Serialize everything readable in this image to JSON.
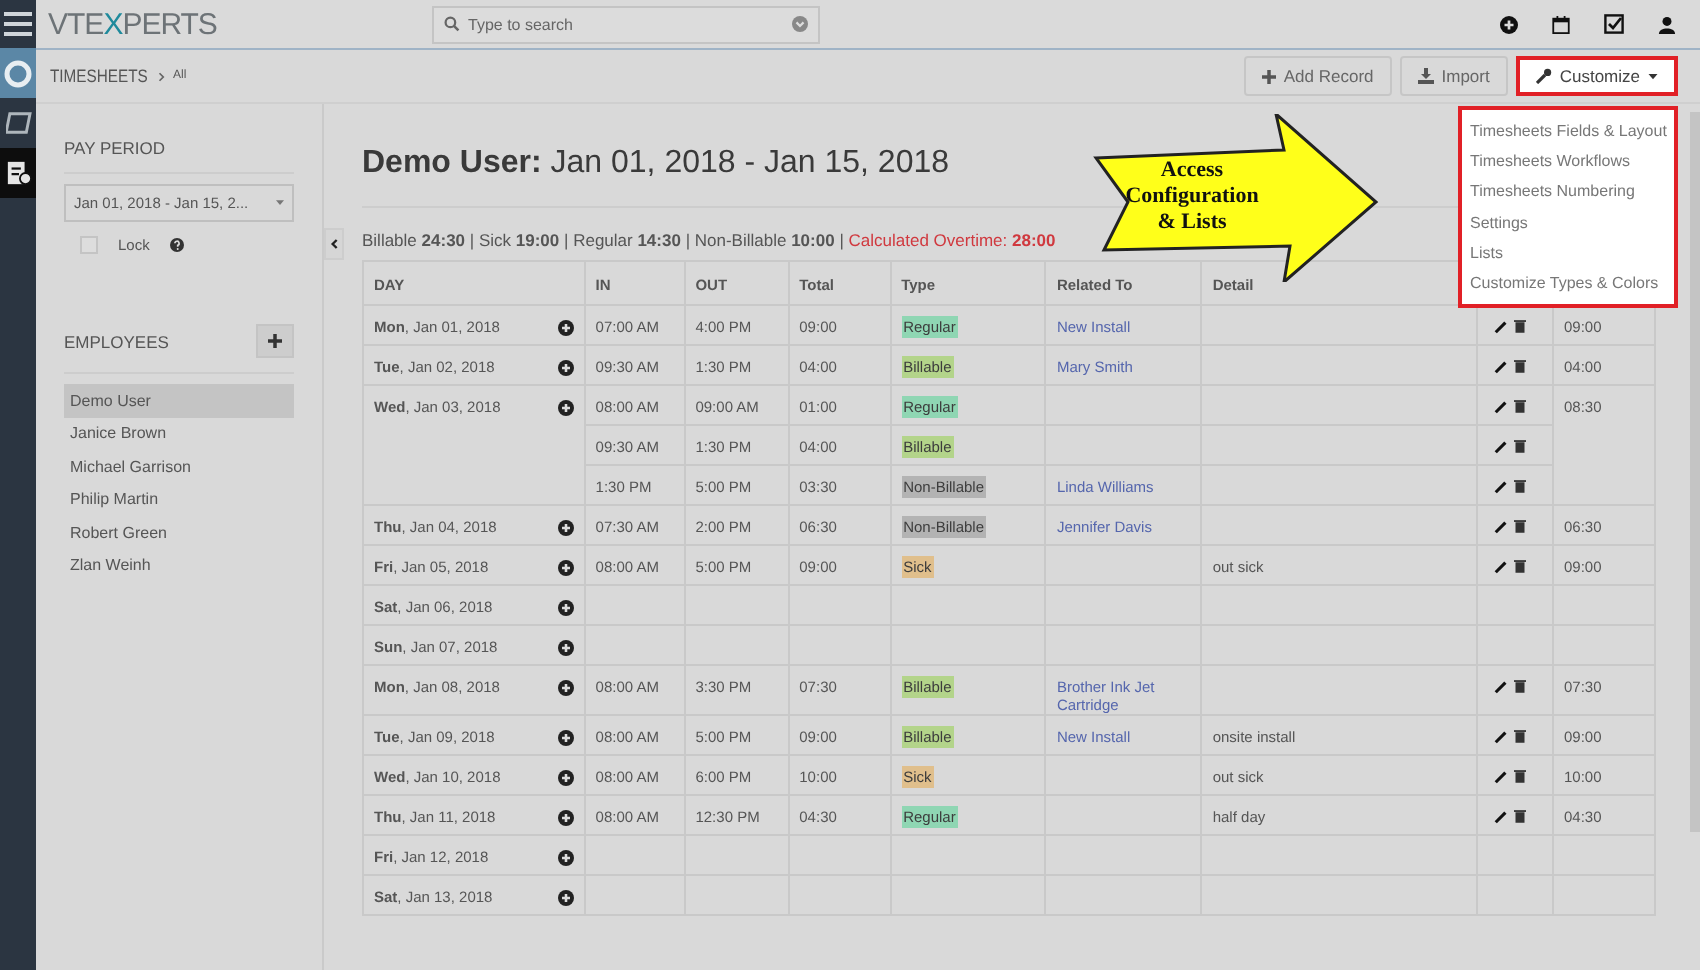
{
  "header": {
    "logo": [
      {
        "text": "VTE",
        "color": "#6d7377"
      },
      {
        "text": "X",
        "color": "#1f8a9c"
      },
      {
        "text": "PERTS",
        "color": "#6d7377"
      }
    ],
    "search": {
      "placeholder": "Type to search"
    }
  },
  "breadcrumb": {
    "module": "TIMESHEETS",
    "view": "All"
  },
  "actions": [
    {
      "kind": "add",
      "label": "Add Record",
      "highlighted": false
    },
    {
      "kind": "import",
      "label": "Import",
      "highlighted": false
    },
    {
      "kind": "customize",
      "label": "Customize",
      "highlighted": true
    }
  ],
  "customize_menu": [
    "Timesheets Fields & Layout",
    "Timesheets Workflows",
    "Timesheets Numbering",
    "Settings",
    "Lists",
    "Customize Types & Colors"
  ],
  "callout": {
    "text": "Access Configuration & Lists"
  },
  "sidebar": {
    "pay_period_label": "PAY PERIOD",
    "pay_period_value": "Jan 01, 2018 - Jan 15, 2...",
    "lock_label": "Lock",
    "lock_checked": false,
    "employees_label": "EMPLOYEES",
    "employees": [
      {
        "name": "Demo User",
        "selected": true
      },
      {
        "name": "Janice Brown",
        "selected": false
      },
      {
        "name": "Michael Garrison",
        "selected": false
      },
      {
        "name": "Philip Martin",
        "selected": false
      },
      {
        "name": "Robert Green",
        "selected": false
      },
      {
        "name": "Zlan Weinh",
        "selected": false
      }
    ]
  },
  "title": "**Demo User:** Jan 01, 2018 - Jan 15, 2018",
  "summary": "Billable **24:30** | Sick **19:00** | Regular **14:30** | Non-Billable **10:00** |",
  "overtime": "Calculated Overtime: **28:00**",
  "table": {
    "columns": [
      "DAY",
      "IN",
      "OUT",
      "Total",
      "Type",
      "Related To",
      "Detail"
    ],
    "days": [
      {
        "day": "**Mon**, Jan 01, 2018",
        "day_total": "09:00",
        "entries": [
          {
            "in": "07:00 AM",
            "out": "4:00 PM",
            "total": "09:00",
            "type": "Regular",
            "color": "#8fd6b3",
            "related": "New Install"
          }
        ]
      },
      {
        "day": "**Tue**, Jan 02, 2018",
        "day_total": "04:00",
        "entries": [
          {
            "in": "09:30 AM",
            "out": "1:30 PM",
            "total": "04:00",
            "type": "Billable",
            "color": "#b3d48a",
            "related": "Mary Smith"
          }
        ]
      },
      {
        "day": "**Wed**, Jan 03, 2018",
        "day_total": "08:30",
        "entries": [
          {
            "in": "08:00 AM",
            "out": "09:00 AM",
            "total": "01:00",
            "type": "Regular",
            "color": "#8fd6b3"
          },
          {
            "in": "09:30 AM",
            "out": "1:30 PM",
            "total": "04:00",
            "type": "Billable",
            "color": "#b3d48a"
          },
          {
            "in": "1:30 PM",
            "out": "5:00 PM",
            "total": "03:30",
            "type": "Non-Billable",
            "color": "#b3b3b3",
            "related": "Linda Williams"
          }
        ]
      },
      {
        "day": "**Thu**, Jan 04, 2018",
        "day_total": "06:30",
        "entries": [
          {
            "in": "07:30 AM",
            "out": "2:00 PM",
            "total": "06:30",
            "type": "Non-Billable",
            "color": "#b3b3b3",
            "related": "Jennifer Davis"
          }
        ]
      },
      {
        "day": "**Fri**, Jan 05, 2018",
        "day_total": "09:00",
        "entries": [
          {
            "in": "08:00 AM",
            "out": "5:00 PM",
            "total": "09:00",
            "type": "Sick",
            "color": "#e0bf8c",
            "detail": "out sick"
          }
        ]
      },
      {
        "day": "**Sat**, Jan 06, 2018"
      },
      {
        "day": "**Sun**, Jan 07, 2018"
      },
      {
        "day": "**Mon**, Jan 08, 2018",
        "day_total": "07:30",
        "entries": [
          {
            "in": "08:00 AM",
            "out": "3:30 PM",
            "total": "07:30",
            "type": "Billable",
            "color": "#b3d48a",
            "related": "Brother Ink Jet Cartridge"
          }
        ]
      },
      {
        "day": "**Tue**, Jan 09, 2018",
        "day_total": "09:00",
        "entries": [
          {
            "in": "08:00 AM",
            "out": "5:00 PM",
            "total": "09:00",
            "type": "Billable",
            "color": "#b3d48a",
            "related": "New Install",
            "detail": "onsite install"
          }
        ]
      },
      {
        "day": "**Wed**, Jan 10, 2018",
        "day_total": "10:00",
        "entries": [
          {
            "in": "08:00 AM",
            "out": "6:00 PM",
            "total": "10:00",
            "type": "Sick",
            "color": "#e0bf8c",
            "detail": "out sick"
          }
        ]
      },
      {
        "day": "**Thu**, Jan 11, 2018",
        "day_total": "04:30",
        "entries": [
          {
            "in": "08:00 AM",
            "out": "12:30 PM",
            "total": "04:30",
            "type": "Regular",
            "color": "#8fd6b3",
            "detail": "half day"
          }
        ]
      },
      {
        "day": "**Fri**, Jan 12, 2018"
      },
      {
        "day": "**Sat**, Jan 13, 2018"
      }
    ]
  }
}
